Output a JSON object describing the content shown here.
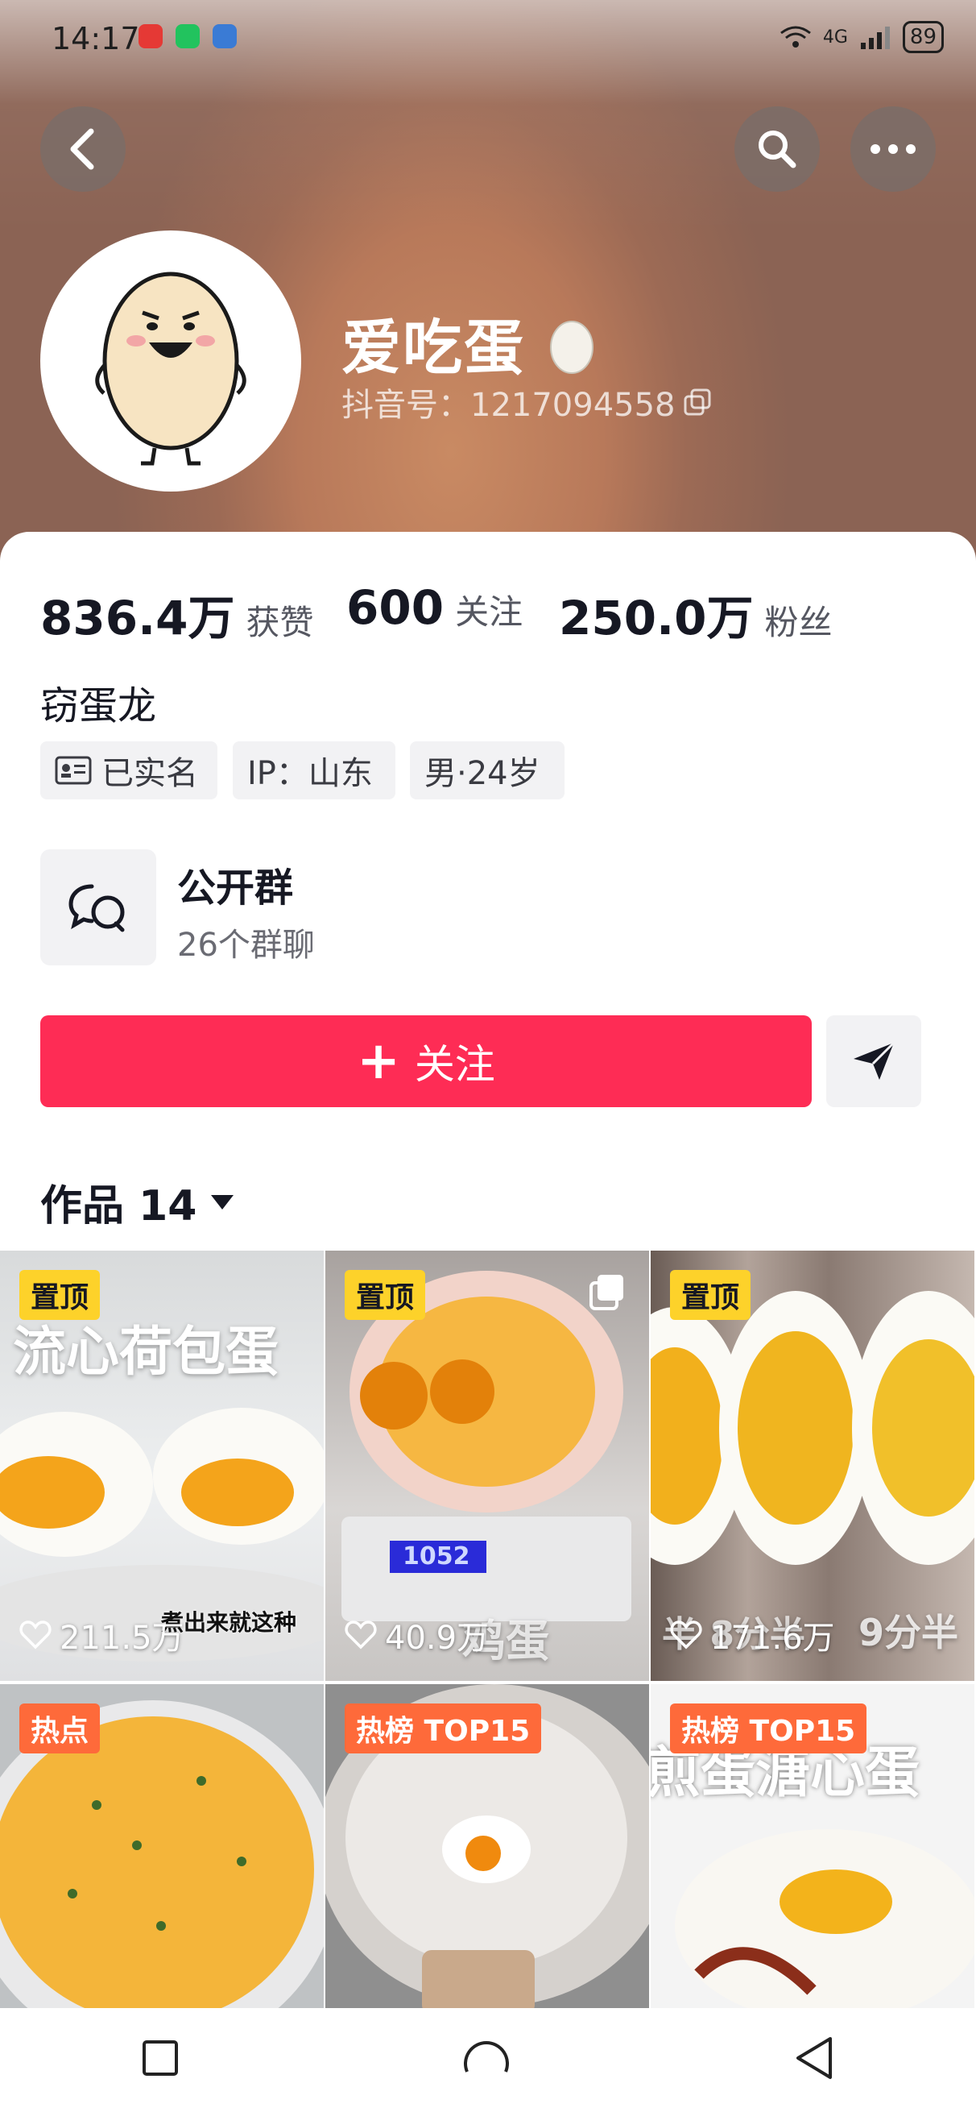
{
  "status_bar": {
    "time": "14:17",
    "network": "4G",
    "battery": "89"
  },
  "profile": {
    "nickname": "爱吃蛋",
    "douyin_id": "抖音号：1217094558",
    "bio": "窃蛋龙",
    "stats": [
      {
        "value": "836.4万",
        "label": "获赞"
      },
      {
        "value": "600",
        "label": "关注"
      },
      {
        "value": "250.0万",
        "label": "粉丝"
      }
    ],
    "tags": [
      {
        "label": "已实名",
        "icon": "id-card-icon"
      },
      {
        "label": "IP：山东"
      },
      {
        "label": "男·24岁"
      }
    ]
  },
  "group": {
    "title": "公开群",
    "count": "26个群聊"
  },
  "actions": {
    "follow_label": "关注",
    "follow_icon": "+"
  },
  "works": {
    "label": "作品 14"
  },
  "videos": [
    {
      "badge": "置顶",
      "badge_type": "pin",
      "likes": "211.5万",
      "overlay": "流心荷包蛋",
      "caption": "煮出来就这种"
    },
    {
      "badge": "置顶",
      "badge_type": "pin",
      "likes": "40.9万",
      "overlay": "鸡蛋",
      "scale_reading": "1052"
    },
    {
      "badge": "置顶",
      "badge_type": "pin",
      "likes": "171.6万",
      "overlay": "9分半",
      "caption": "半 8分半"
    },
    {
      "badge": "热点",
      "badge_type": "hot"
    },
    {
      "badge": "热榜 TOP15",
      "badge_type": "hot"
    },
    {
      "badge": "热榜 TOP15",
      "badge_type": "hot",
      "overlay": "煎蛋溏心蛋"
    }
  ],
  "colors": {
    "accent": "#fe2c55",
    "pin_badge": "#fdd22a",
    "hot_badge": "#fe6a3a"
  }
}
